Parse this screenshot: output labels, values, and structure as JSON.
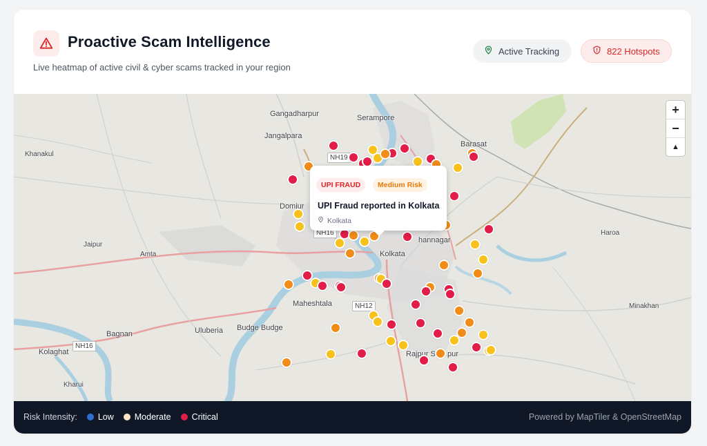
{
  "header": {
    "title": "Proactive Scam Intelligence",
    "subtitle": "Live heatmap of active civil & cyber scams tracked in your region",
    "title_icon": "warning-triangle-icon"
  },
  "pills": {
    "tracking_label": "Active Tracking",
    "tracking_icon": "map-pin-icon",
    "hotspots_label": "822 Hotspots",
    "hotspots_icon": "shield-alert-icon"
  },
  "map": {
    "labels": {
      "gangadharpur": "Gangadharpur",
      "serampore": "Serampore",
      "jangalpara": "Jangalpara",
      "khanakul": "Khanakul",
      "barasat": "Barasat",
      "domjur": "Domjur",
      "jaipur": "Jaipur",
      "amta": "Amta",
      "haroa": "Haroa",
      "kolkata": "Kolkata",
      "bidhannagar": "hannagar",
      "maheshtala": "Maheshtala",
      "uluberia": "Uluberia",
      "budge_budge": "Budge Budge",
      "bagnan": "Bagnan",
      "kolaghat": "Kolaghat",
      "minakhan": "Minakhan",
      "rajpur": "Rajpur So",
      "rajpur_tail": "pur",
      "kharui": "Kharui"
    },
    "shields": {
      "nh19": "NH19",
      "nh16a": "NH16",
      "nh12": "NH12",
      "nh16b": "NH16"
    },
    "zoom": {
      "in": "+",
      "out": "−",
      "north": "▲"
    }
  },
  "colors": {
    "critical": "#e11d48",
    "moderate_orange": "#f28c18",
    "moderate_yellow": "#f8c21c",
    "low": "#2f6fce"
  },
  "popup": {
    "type_badge": "UPI FRAUD",
    "risk_badge": "Medium Risk",
    "title": "UPI Fraud reported in Kolkata",
    "location": "Kolkata"
  },
  "footer": {
    "legend_label": "Risk Intensity:",
    "low": "Low",
    "moderate": "Moderate",
    "critical": "Critical",
    "attribution": "Powered by MapTiler & OpenStreetMap"
  }
}
